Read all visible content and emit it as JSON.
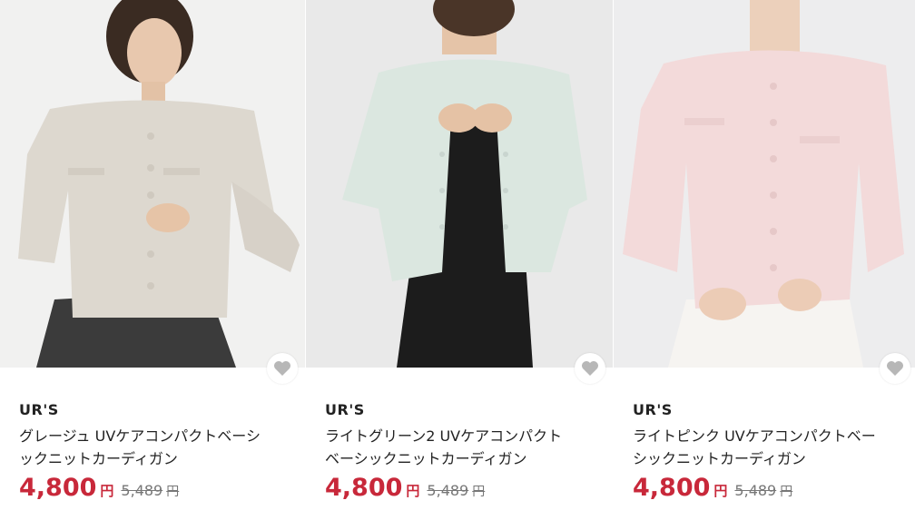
{
  "products": [
    {
      "brand": "UR'S",
      "title": "グレージュ UVケアコンパクトベーシ\nックニットカーディガン",
      "price": "4,800",
      "price_unit": "円",
      "original_price": "5,489",
      "original_unit": "円",
      "image": "model-wearing-greige-cardigan",
      "icon": "heart-icon",
      "colors": {
        "bg": "#f1f1f0",
        "garment": "#ddd8cf",
        "skirt": "#3b3b3b"
      }
    },
    {
      "brand": "UR'S",
      "title": "ライトグリーン2 UVケアコンパクト\nベーシックニットカーディガン",
      "price": "4,800",
      "price_unit": "円",
      "original_price": "5,489",
      "original_unit": "円",
      "image": "model-wearing-light-green-cardigan",
      "icon": "heart-icon",
      "colors": {
        "bg": "#e9e9e9",
        "garment": "#dbe7e0",
        "skirt": "#1c1c1c"
      }
    },
    {
      "brand": "UR'S",
      "title": "ライトピンク UVケアコンパクトベー\nシックニットカーディガン",
      "price": "4,800",
      "price_unit": "円",
      "original_price": "5,489",
      "original_unit": "円",
      "image": "model-wearing-light-pink-cardigan",
      "icon": "heart-icon",
      "colors": {
        "bg": "#ededee",
        "garment": "#f3dada",
        "skirt": "#f6f4f1"
      }
    }
  ],
  "accent_color": "#c8283a"
}
